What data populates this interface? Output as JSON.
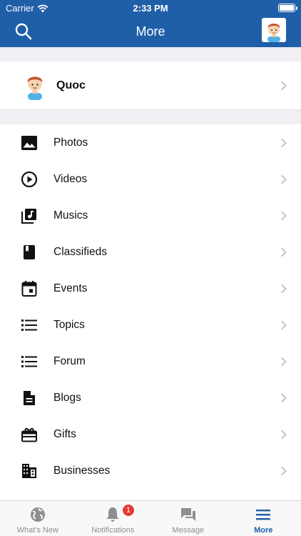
{
  "status": {
    "carrier": "Carrier",
    "time": "2:33 PM"
  },
  "nav": {
    "title": "More"
  },
  "profile": {
    "name": "Quoc"
  },
  "menu": [
    {
      "label": "Photos",
      "icon": "photo-icon"
    },
    {
      "label": "Videos",
      "icon": "play-circle-icon"
    },
    {
      "label": "Musics",
      "icon": "music-library-icon"
    },
    {
      "label": "Classifieds",
      "icon": "book-icon"
    },
    {
      "label": "Events",
      "icon": "calendar-icon"
    },
    {
      "label": "Topics",
      "icon": "list-icon"
    },
    {
      "label": "Forum",
      "icon": "list-icon"
    },
    {
      "label": "Blogs",
      "icon": "document-icon"
    },
    {
      "label": "Gifts",
      "icon": "gift-icon"
    },
    {
      "label": "Businesses",
      "icon": "building-icon"
    }
  ],
  "tabs": [
    {
      "label": "What's New",
      "icon": "globe-icon"
    },
    {
      "label": "Notifications",
      "icon": "bell-icon",
      "badge": "1"
    },
    {
      "label": "Message",
      "icon": "chat-icon"
    },
    {
      "label": "More",
      "icon": "menu-icon",
      "active": true
    }
  ],
  "colors": {
    "header": "#1f5fa8",
    "badge": "#e53935",
    "background_gap": "#f0f0f4"
  }
}
